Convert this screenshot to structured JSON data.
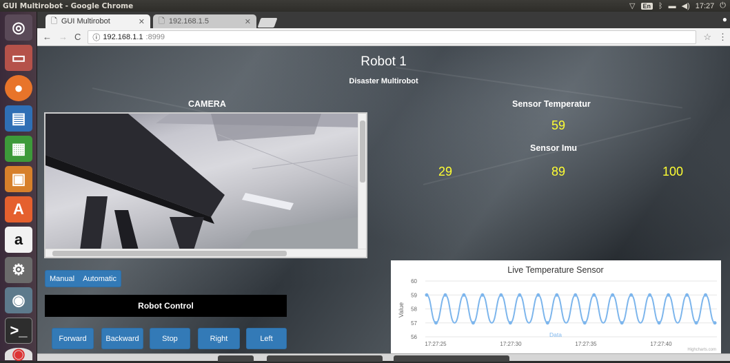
{
  "os": {
    "window_title": "GUI Multirobot - Google Chrome",
    "keyboard": "En",
    "clock": "17:27",
    "launcher_icons": [
      "ubuntu-dash-icon",
      "file-manager-icon",
      "firefox-icon",
      "writer-icon",
      "calc-icon",
      "impress-icon",
      "software-center-icon",
      "amazon-icon",
      "system-settings-icon",
      "disk-icon",
      "terminal-icon",
      "chrome-icon"
    ]
  },
  "browser": {
    "tabs": [
      {
        "label": "GUI Multirobot",
        "active": true
      },
      {
        "label": "192.168.1.5",
        "active": false
      }
    ],
    "url_host": "192.168.1.1",
    "url_port": ":8999"
  },
  "page": {
    "title": "Robot 1",
    "subtitle": "Disaster Multirobot",
    "camera_label": "CAMERA",
    "temp_label": "Sensor Temperatur",
    "temp_value": "59",
    "imu_label": "Sensor Imu",
    "imu_values": [
      "29",
      "89",
      "100"
    ],
    "mode_buttons": [
      "Manual",
      "Automatic"
    ],
    "control_label": "Robot Control",
    "control_buttons": [
      "Forward",
      "Backward",
      "Stop",
      "Right",
      "Left"
    ]
  },
  "chart_data": {
    "type": "line",
    "title": "Live Temperature Sensor",
    "ylabel": "Value",
    "ylim": [
      56,
      60
    ],
    "yticks": [
      "60",
      "59",
      "58",
      "57",
      "56"
    ],
    "xtick_labels": [
      "17:27:25",
      "17:27:30",
      "17:27:35",
      "17:27:40"
    ],
    "series": [
      {
        "name": "Data",
        "color": "#7cb5ec",
        "values": [
          59,
          57,
          59,
          57,
          59,
          57,
          59,
          57,
          59,
          57,
          59,
          57,
          59,
          57,
          59,
          57,
          59,
          57,
          59,
          57,
          59,
          57,
          59,
          57,
          59,
          57,
          59,
          57,
          59,
          57,
          59,
          57
        ]
      }
    ],
    "credit": "Highcharts.com"
  }
}
